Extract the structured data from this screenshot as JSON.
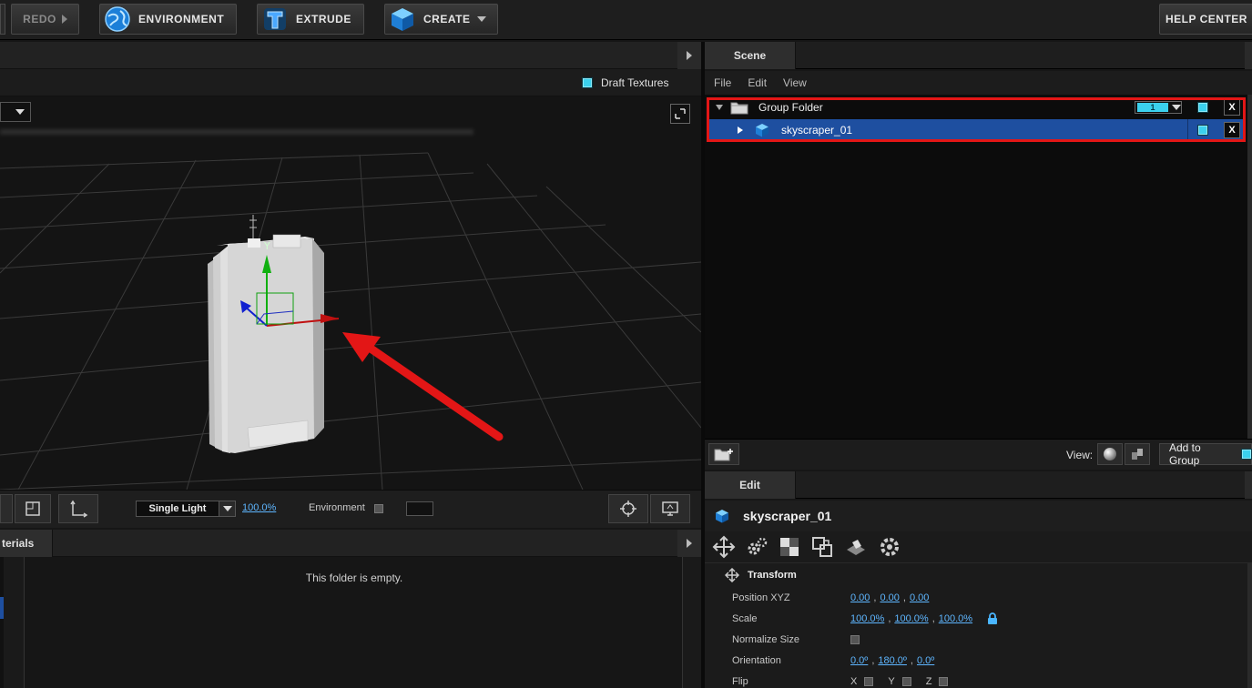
{
  "toolbar": {
    "redo_label": "REDO",
    "environment_label": "ENVIRONMENT",
    "extrude_label": "EXTRUDE",
    "create_label": "CREATE",
    "help_label": "HELP CENTER"
  },
  "viewport": {
    "draft_textures_label": "Draft Textures",
    "lighting_select": "Single Light",
    "zoom_percent": "100.0%",
    "environment_label": "Environment"
  },
  "materials": {
    "tab_label": "terials",
    "empty_message": "This folder is empty."
  },
  "scene": {
    "tab_label": "Scene",
    "menu": [
      "File",
      "Edit",
      "View"
    ],
    "items": [
      {
        "label": "Group Folder",
        "badge": "1"
      },
      {
        "label": "skyscraper_01"
      }
    ],
    "view_label": "View:",
    "add_group_label": "Add to Group"
  },
  "edit": {
    "tab_label": "Edit",
    "object_name": "skyscraper_01",
    "section_label": "Transform",
    "props": {
      "position_label": "Position XYZ",
      "position": [
        "0.00",
        "0.00",
        "0.00"
      ],
      "scale_label": "Scale",
      "scale": [
        "100.0%",
        "100.0%",
        "100.0%"
      ],
      "normalize_label": "Normalize Size",
      "orientation_label": "Orientation",
      "orientation": [
        "0.0º",
        "180.0º",
        "0.0º"
      ],
      "flip_label": "Flip",
      "flip_axes": [
        "X",
        "Y",
        "Z"
      ]
    }
  },
  "colors": {
    "accent_cyan": "#3bd1ee",
    "selection_blue": "#1e4fa0",
    "highlight_red": "#e31616",
    "link_blue": "#5eb6ff"
  }
}
